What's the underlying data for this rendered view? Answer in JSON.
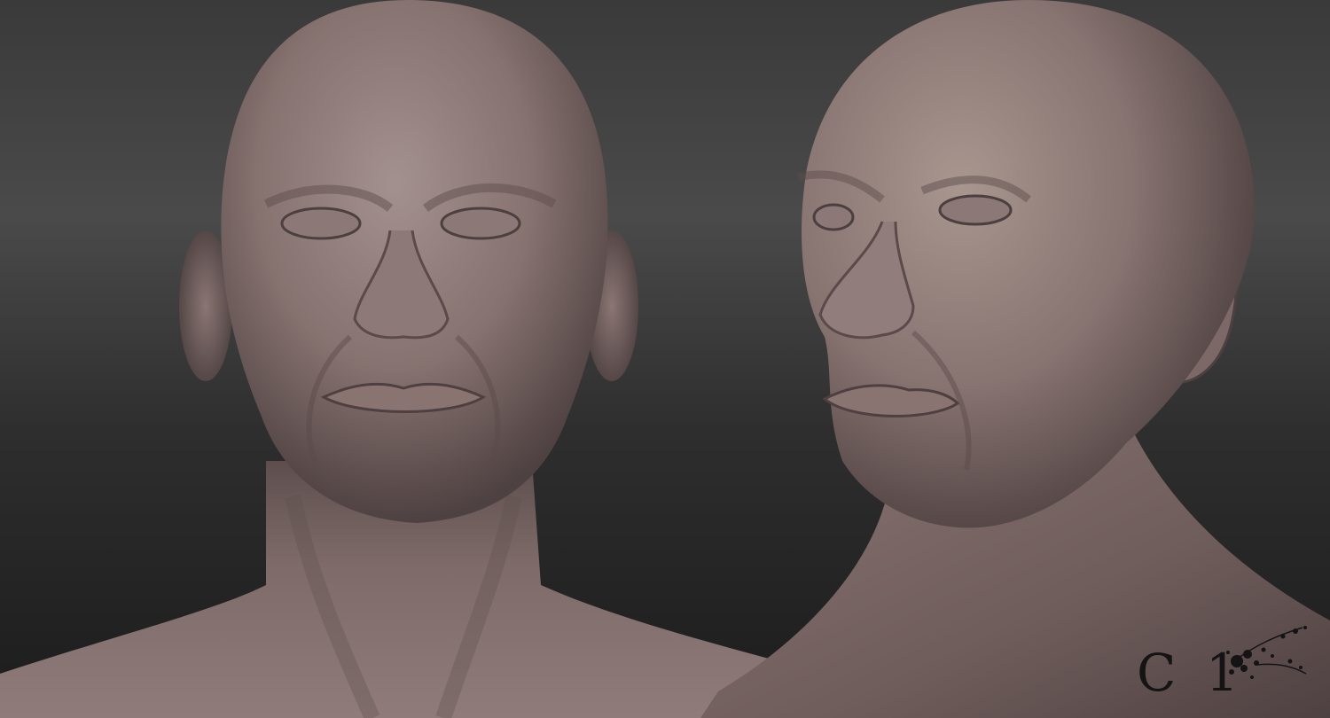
{
  "image": {
    "description_tags": [
      "3d-sculpt-render",
      "bald-male-head"
    ],
    "views": [
      {
        "name": "front-view"
      },
      {
        "name": "three-quarter-view"
      }
    ]
  },
  "colors": {
    "background_top": "#474747",
    "background_bottom": "#1c1c1c",
    "clay_light": "#9b8a88",
    "clay_mid": "#7a6765",
    "clay_shadow": "#4a3d3d",
    "signature_ink": "#141414"
  },
  "signature": {
    "letter": "C",
    "number": "1"
  }
}
